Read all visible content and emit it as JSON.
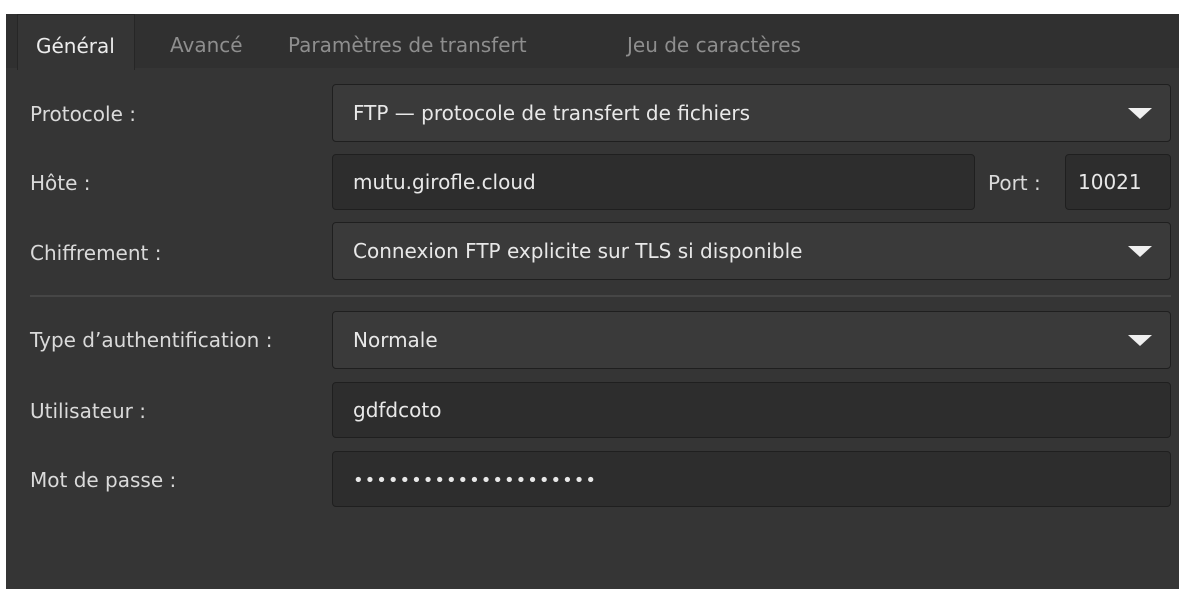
{
  "tabs": [
    {
      "label": "Général",
      "active": true
    },
    {
      "label": "Avancé",
      "active": false
    },
    {
      "label": "Paramètres de transfert",
      "active": false
    },
    {
      "label": "Jeu de caractères",
      "active": false
    }
  ],
  "protocol": {
    "label": "Protocole :",
    "value": "FTP — protocole de transfert de fichiers"
  },
  "host": {
    "label": "Hôte :",
    "value": "mutu.girofle.cloud"
  },
  "port": {
    "label": "Port :",
    "value": "10021"
  },
  "encryption": {
    "label": "Chiffrement :",
    "value": "Connexion FTP explicite sur TLS si disponible"
  },
  "auth_type": {
    "label": "Type d’authentification :",
    "value": "Normale"
  },
  "user": {
    "label": "Utilisateur :",
    "value": "gdfdcoto"
  },
  "password": {
    "label": "Mot de passe :",
    "value": "•••••••••••••••••••••"
  },
  "icons": {
    "dropdown": "chevron-down-icon"
  }
}
